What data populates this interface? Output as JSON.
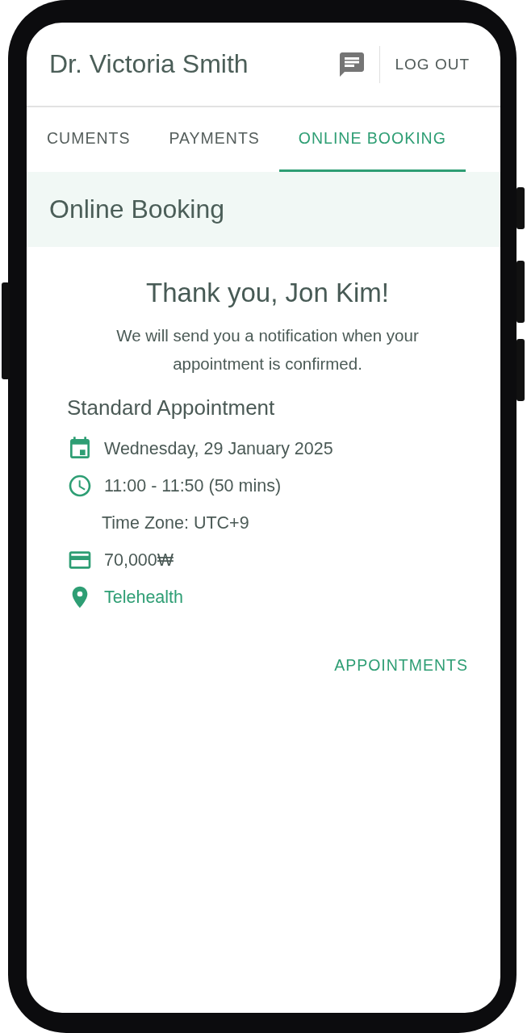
{
  "header": {
    "title": "Dr. Victoria Smith",
    "logout": "LOG OUT"
  },
  "tabs": [
    {
      "label": "CUMENTS",
      "selected": false
    },
    {
      "label": "PAYMENTS",
      "selected": false
    },
    {
      "label": "ONLINE BOOKING",
      "selected": true
    }
  ],
  "section_title": "Online Booking",
  "confirmation": {
    "heading": "Thank you, Jon Kim!",
    "message": "We will send you a notification when your appointment is confirmed."
  },
  "appointment": {
    "title": "Standard Appointment",
    "details": [
      {
        "kind": "date",
        "text": "Wednesday, 29 January 2025"
      },
      {
        "kind": "time",
        "text": "11:00 - 11:50 (50 mins)"
      },
      {
        "kind": "timezone",
        "text": "Time Zone: UTC+9"
      },
      {
        "kind": "price",
        "text": "70,000₩"
      },
      {
        "kind": "location",
        "text": "Telehealth"
      }
    ]
  },
  "action": "APPOINTMENTS"
}
